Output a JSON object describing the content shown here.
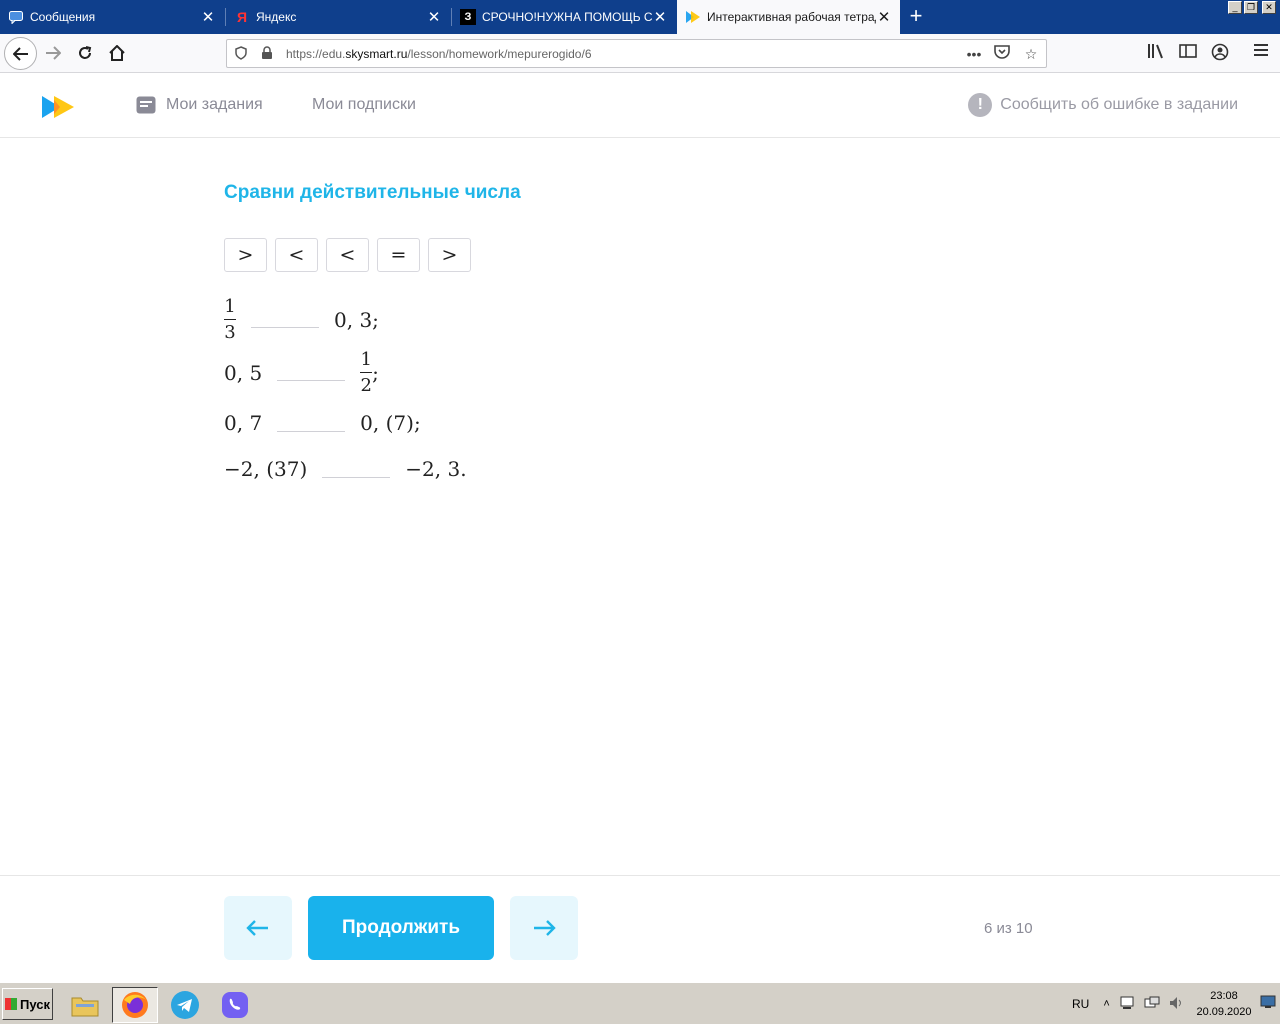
{
  "browser": {
    "tabs": [
      {
        "title": "Сообщения",
        "icon": "chat-icon",
        "active": false
      },
      {
        "title": "Яндекс",
        "icon": "yandex-icon",
        "active": false
      },
      {
        "title": "СРОЧНО!НУЖНА ПОМОЩЬ С АЛ",
        "icon": "znanija-icon",
        "active": false
      },
      {
        "title": "Интерактивная рабочая тетрад",
        "icon": "skysmart-icon",
        "active": true
      }
    ],
    "url_prefix": "https://edu.",
    "url_host": "skysmart.ru",
    "url_path": "/lesson/homework/mepurerogido/6"
  },
  "header": {
    "nav": [
      {
        "label": "Мои задания",
        "icon": "tasks-icon"
      },
      {
        "label": "Мои подписки"
      }
    ],
    "report_label": "Сообщить об ошибке в задании"
  },
  "task": {
    "title": "Сравни действительные числа",
    "options": [
      ">",
      "<",
      "<",
      "=",
      ">"
    ],
    "rows": [
      {
        "left_num": "1",
        "left_den": "3",
        "right": "0, 3;"
      },
      {
        "left": "0, 5",
        "right_num": "1",
        "right_den": "2",
        "right_suffix": ";"
      },
      {
        "left": "0, 7",
        "right": "0, (7);"
      },
      {
        "left": "−2, (37)",
        "right": "−2, 3."
      }
    ]
  },
  "footer": {
    "continue_label": "Продолжить",
    "progress": "6 из 10",
    "accent_color": "#19b2ec"
  },
  "taskbar": {
    "start_label": "Пуск",
    "language": "RU",
    "time": "23:08",
    "date": "20.09.2020"
  }
}
